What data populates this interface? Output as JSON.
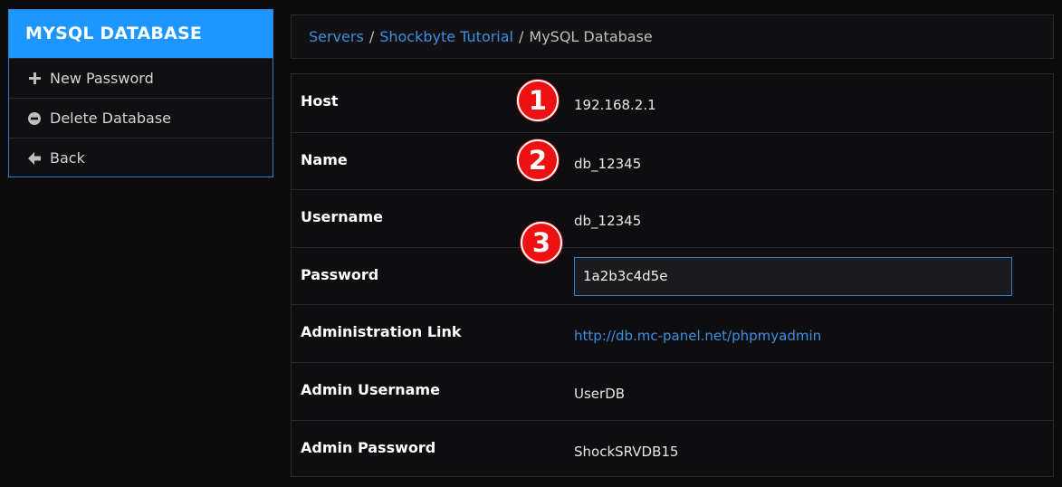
{
  "sidebar": {
    "title": "MYSQL DATABASE",
    "items": [
      {
        "label": "New Password",
        "icon": "plus-icon"
      },
      {
        "label": "Delete Database",
        "icon": "minus-circle-icon"
      },
      {
        "label": "Back",
        "icon": "arrow-left-icon"
      }
    ]
  },
  "breadcrumb": {
    "items": [
      "Servers",
      "Shockbyte Tutorial",
      "MySQL Database"
    ],
    "separator": "/"
  },
  "details": {
    "host": {
      "label": "Host",
      "value": "192.168.2.1"
    },
    "name": {
      "label": "Name",
      "value": "db_12345"
    },
    "username": {
      "label": "Username",
      "value": "db_12345"
    },
    "password": {
      "label": "Password",
      "value": "1a2b3c4d5e"
    },
    "admin_link": {
      "label": "Administration Link",
      "value": "http://db.mc-panel.net/phpmyadmin"
    },
    "admin_username": {
      "label": "Admin Username",
      "value": "UserDB"
    },
    "admin_password": {
      "label": "Admin Password",
      "value": "ShockSRVDB15"
    }
  },
  "markers": [
    "1",
    "2",
    "3"
  ],
  "colors": {
    "accent": "#1d96ff",
    "link": "#3d8fe0",
    "marker": "#ee1111",
    "background": "#0b0b0c"
  }
}
